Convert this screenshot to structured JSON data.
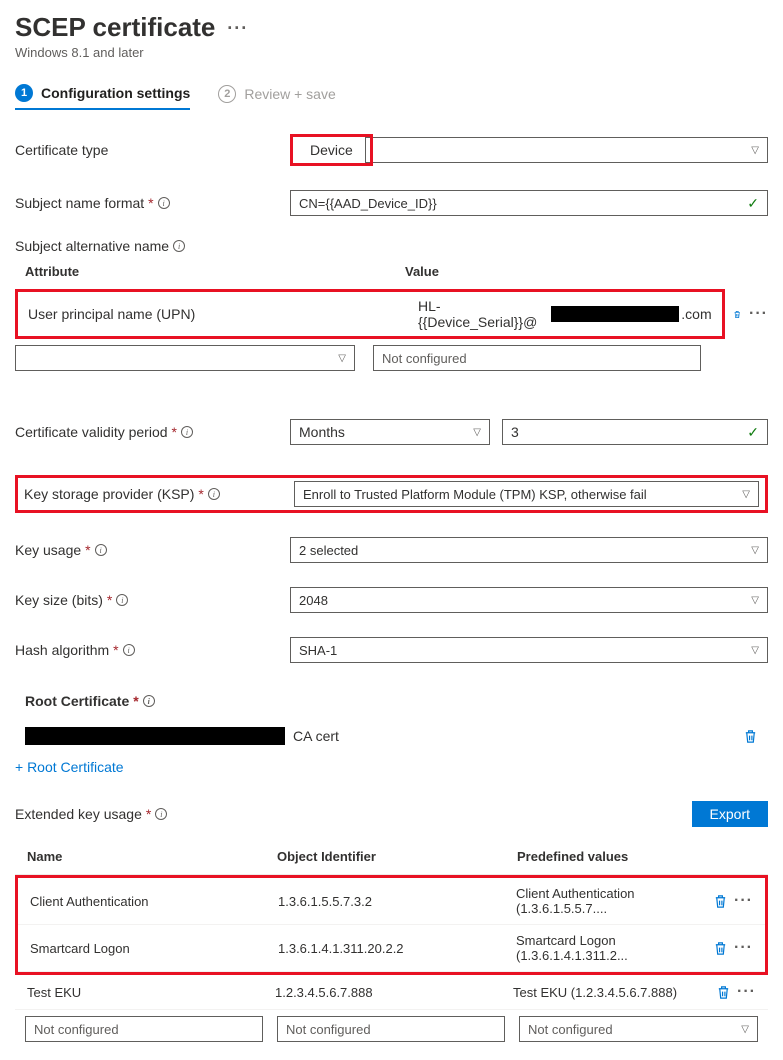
{
  "header": {
    "title": "SCEP certificate",
    "subtitle": "Windows 8.1 and later"
  },
  "tabs": {
    "step1_num": "1",
    "step1_label": "Configuration settings",
    "step2_num": "2",
    "step2_label": "Review + save"
  },
  "cert_type": {
    "label": "Certificate type",
    "value": "Device"
  },
  "subj_fmt": {
    "label": "Subject name format",
    "value": "CN={{AAD_Device_ID}}"
  },
  "san": {
    "label": "Subject alternative name",
    "col_attr": "Attribute",
    "col_val": "Value",
    "row_attr": "User principal name (UPN)",
    "row_val_pre": "HL-{{Device_Serial}}@",
    "row_val_post": ".com",
    "add_placeholder": "Not configured"
  },
  "validity": {
    "label": "Certificate validity period",
    "unit": "Months",
    "value": "3"
  },
  "ksp": {
    "label": "Key storage provider (KSP)",
    "value": "Enroll to Trusted Platform Module (TPM) KSP, otherwise fail"
  },
  "key_usage": {
    "label": "Key usage",
    "value": "2 selected"
  },
  "key_size": {
    "label": "Key size (bits)",
    "value": "2048"
  },
  "hash": {
    "label": "Hash algorithm",
    "value": "SHA-1"
  },
  "root": {
    "label": "Root Certificate",
    "suffix": " CA cert",
    "link": "+ Root Certificate"
  },
  "eku": {
    "label": "Extended key usage",
    "export": "Export",
    "col_name": "Name",
    "col_oid": "Object Identifier",
    "col_pred": "Predefined values",
    "rows": [
      {
        "name": "Client Authentication",
        "oid": "1.3.6.1.5.5.7.3.2",
        "pred": "Client Authentication (1.3.6.1.5.5.7...."
      },
      {
        "name": "Smartcard Logon",
        "oid": "1.3.6.1.4.1.311.20.2.2",
        "pred": "Smartcard Logon (1.3.6.1.4.1.311.2..."
      }
    ],
    "row3": {
      "name": "Test EKU",
      "oid": "1.2.3.4.5.6.7.888",
      "pred": "Test EKU (1.2.3.4.5.6.7.888)"
    },
    "add_placeholder": "Not configured"
  }
}
